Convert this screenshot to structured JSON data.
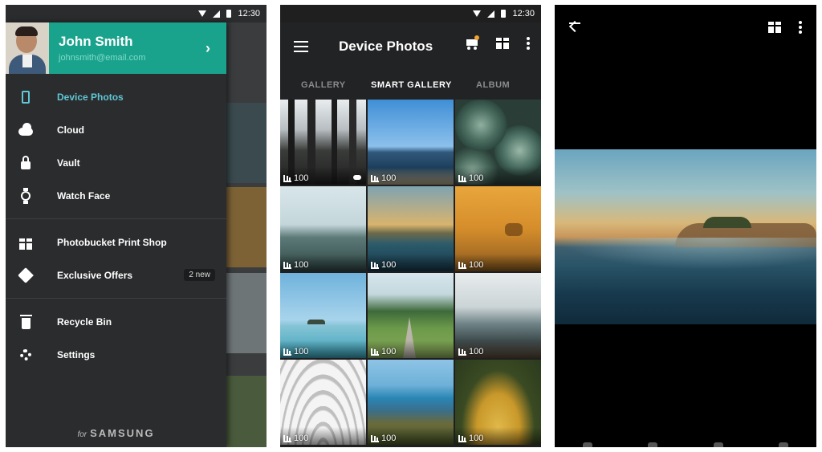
{
  "status": {
    "time": "12:30"
  },
  "drawer": {
    "user_name": "John Smith",
    "user_email": "johnsmith@email.com",
    "groups": [
      [
        {
          "label": "Device Photos",
          "icon": "phone-icon",
          "active": true
        },
        {
          "label": "Cloud",
          "icon": "cloud-icon"
        },
        {
          "label": "Vault",
          "icon": "lock-icon"
        },
        {
          "label": "Watch Face",
          "icon": "watch-icon"
        }
      ],
      [
        {
          "label": "Photobucket Print Shop",
          "icon": "gift-icon"
        },
        {
          "label": "Exclusive Offers",
          "icon": "tag-icon",
          "badge": "2 new"
        }
      ],
      [
        {
          "label": "Recycle Bin",
          "icon": "trash-icon"
        },
        {
          "label": "Settings",
          "icon": "gear-icon"
        }
      ]
    ],
    "footer_for": "for",
    "footer_brand": "SAMSUNG"
  },
  "gallery": {
    "title": "Device Photos",
    "tabs": [
      {
        "label": "GALLERY",
        "active": false
      },
      {
        "label": "SMART GALLERY",
        "active": true
      },
      {
        "label": "ALBUM",
        "active": false
      }
    ],
    "tiles": [
      {
        "count": "100"
      },
      {
        "count": "100"
      },
      {
        "count": "100"
      },
      {
        "count": "100"
      },
      {
        "count": "100"
      },
      {
        "count": "100"
      },
      {
        "count": "100"
      },
      {
        "count": "100"
      },
      {
        "count": "100"
      },
      {
        "count": "100"
      },
      {
        "count": "100"
      },
      {
        "count": "100"
      }
    ]
  },
  "colors": {
    "accent": "#1aa38c",
    "active_nav": "#5fc7d5",
    "cart_dot": "#f2a230"
  }
}
